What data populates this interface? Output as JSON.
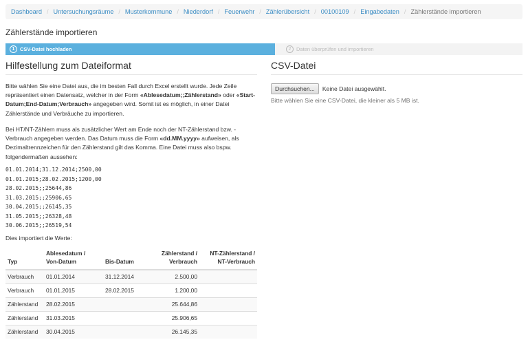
{
  "breadcrumb": {
    "items": [
      "Dashboard",
      "Untersuchungsräume",
      "Musterkommune",
      "Niederdorf",
      "Feuerwehr",
      "Zählerübersicht",
      "00100109",
      "Eingabedaten"
    ],
    "current": "Zählerstände importieren"
  },
  "page_title": "Zählerstände importieren",
  "wizard": {
    "step1": {
      "number": "1",
      "label": "CSV-Datei hochladen"
    },
    "step2": {
      "number": "2",
      "label": "Daten überprüfen und importieren"
    }
  },
  "help": {
    "title": "Hilfestellung zum Dateiformat",
    "p1_a": "Bitte wählen Sie eine Datei aus, die im besten Fall durch Excel erstellt wurde. Jede Zeile repräsentiert einen Datensatz, welcher in der Form ",
    "p1_b": "«Ablesedatum;;Zählerstand»",
    "p1_c": " oder ",
    "p1_d": "«Start-Datum;End-Datum;Verbrauch»",
    "p1_e": " angegeben wird. Somit ist es möglich, in einer Datei Zählerstände und Verbräuche zu importieren.",
    "p2_a": "Bei HT/NT-Zählern muss als zusätzlicher Wert am Ende noch der NT-Zählerstand bzw. -Verbrauch angegeben werden. Das Datum muss die Form ",
    "p2_b": "«dd.MM.yyyy»",
    "p2_c": " aufweisen, als Dezimaltrennzeichen für den Zählerstand gilt das Komma. Eine Datei muss also bspw. folgendermaßen aussehen:",
    "example_lines": [
      "01.01.2014;31.12.2014;2500,00",
      "01.01.2015;28.02.2015;1200,00",
      "28.02.2015;;25644,86",
      "31.03.2015;;25906,65",
      "30.04.2015;;26145,35",
      "31.05.2015;;26328,48",
      "30.06.2015;;26519,54"
    ],
    "p3": "Dies importiert die Werte:"
  },
  "table": {
    "headers": {
      "typ": "Typ",
      "von_1": "Ablesedatum /",
      "von_2": "Von-Datum",
      "bis": "Bis-Datum",
      "zs_1": "Zählerstand /",
      "zs_2": "Verbrauch",
      "nt_1": "NT-Zählerstand /",
      "nt_2": "NT-Verbrauch"
    },
    "rows": [
      {
        "typ": "Verbrauch",
        "von": "01.01.2014",
        "bis": "31.12.2014",
        "zs": "2.500,00",
        "nt": ""
      },
      {
        "typ": "Verbrauch",
        "von": "01.01.2015",
        "bis": "28.02.2015",
        "zs": "1.200,00",
        "nt": ""
      },
      {
        "typ": "Zählerstand",
        "von": "28.02.2015",
        "bis": "",
        "zs": "25.644,86",
        "nt": ""
      },
      {
        "typ": "Zählerstand",
        "von": "31.03.2015",
        "bis": "",
        "zs": "25.906,65",
        "nt": ""
      },
      {
        "typ": "Zählerstand",
        "von": "30.04.2015",
        "bis": "",
        "zs": "26.145,35",
        "nt": ""
      }
    ]
  },
  "csv": {
    "title": "CSV-Datei",
    "button_label": "Durchsuchen...",
    "status": "Keine Datei ausgewählt.",
    "help": "Bitte wählen Sie eine CSV-Datei, die kleiner als 5 MB ist."
  },
  "colors": {
    "link": "#3a8cc4",
    "wizard_active": "#5bb0de",
    "wizard_inactive": "#f3f3f3"
  }
}
